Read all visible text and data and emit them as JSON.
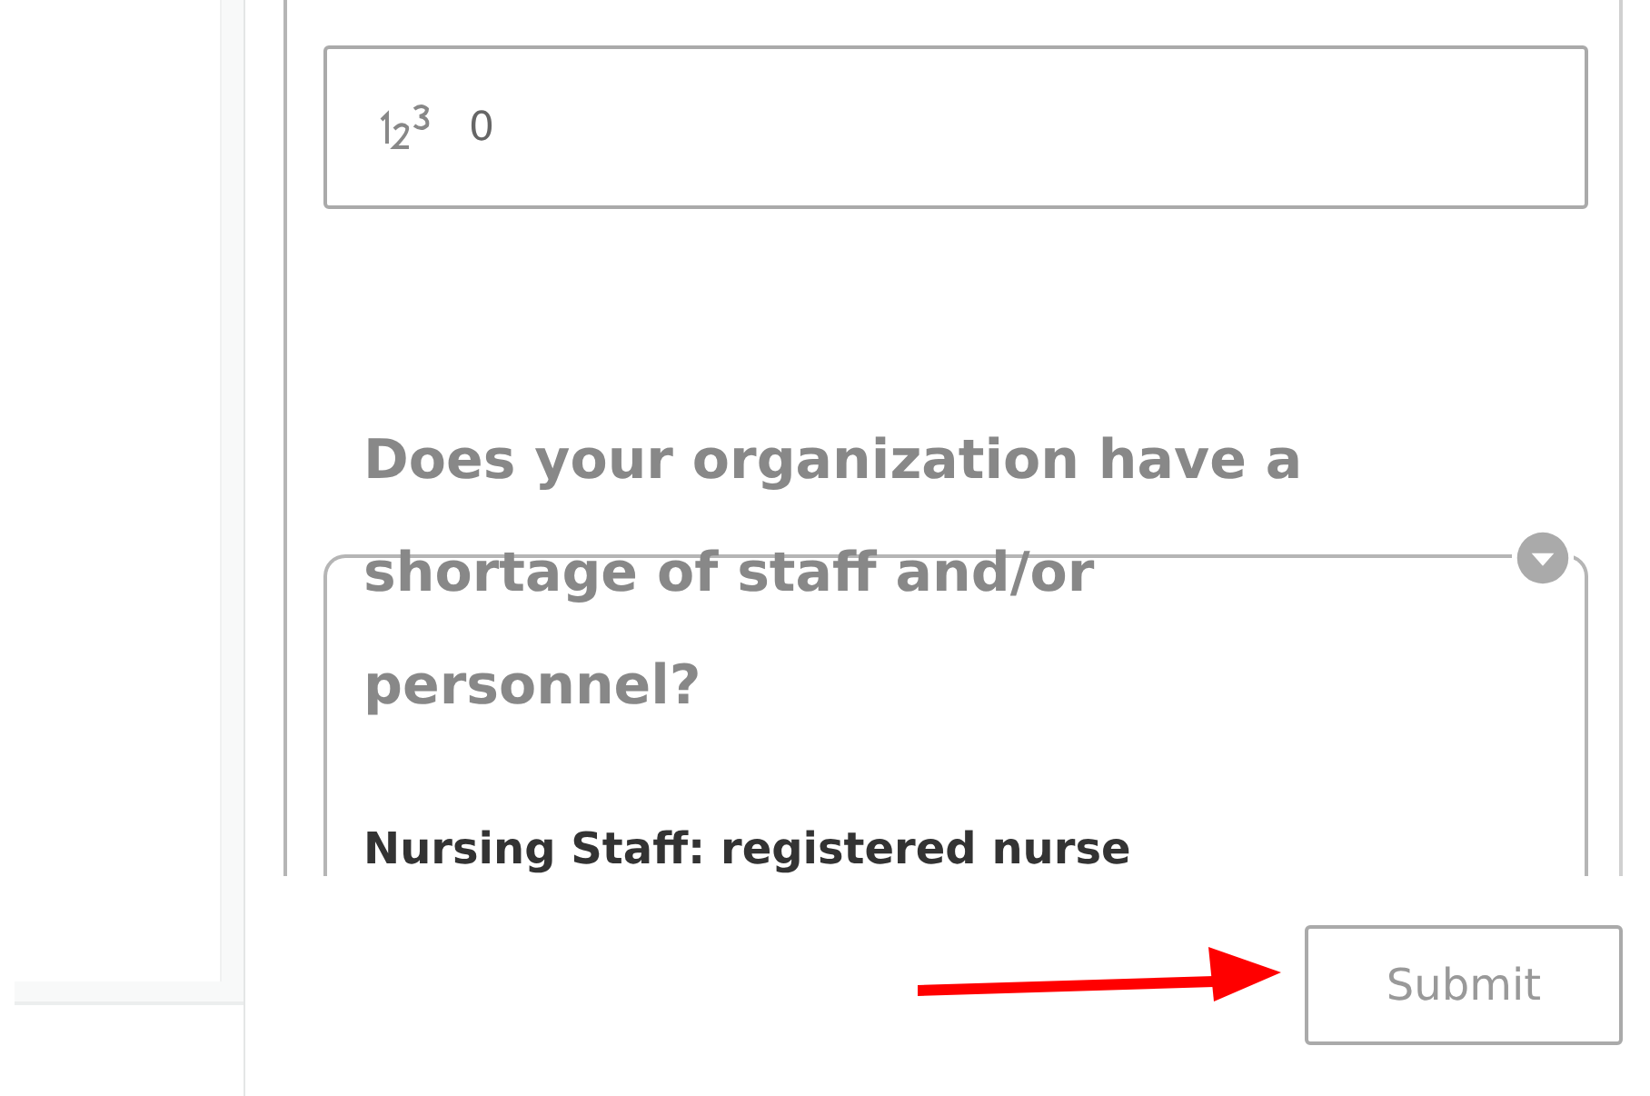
{
  "number_field": {
    "value": "0"
  },
  "question": {
    "title": "Does your organization have a shortage of staff and/or personnel?",
    "expanded": false,
    "first_option": "Nursing Staff: registered nurse"
  },
  "submit_button": {
    "label": "Submit",
    "disabled": true
  }
}
